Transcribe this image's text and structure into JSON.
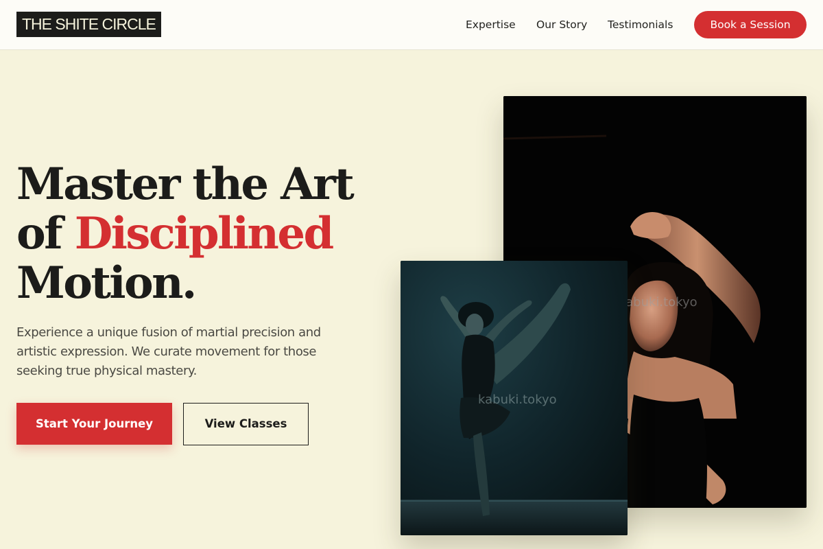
{
  "header": {
    "logo": "THE SHITE CIRCLE",
    "nav": [
      "Expertise",
      "Our Story",
      "Testimonials"
    ],
    "cta": "Book a Session"
  },
  "hero": {
    "headline_line1": "Master the Art",
    "headline_line2_pre": "of ",
    "headline_line2_accent": "Disciplined",
    "headline_line3": "Motion.",
    "subtext": "Experience a unique fusion of martial precision and artistic expression. We curate movement for those seeking true physical mastery.",
    "primary_button": "Start Your Journey",
    "secondary_button": "View Classes"
  },
  "images": {
    "back_watermark": "kabuki.tokyo",
    "front_watermark": "kabuki.tokyo"
  },
  "colors": {
    "background": "#f6f3dc",
    "accent": "#d42f31",
    "dark": "#1c1c1a"
  }
}
